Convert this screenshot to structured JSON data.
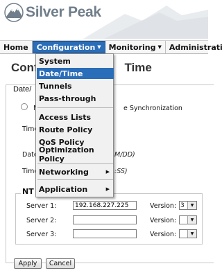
{
  "brand": {
    "name": "Silver Peak"
  },
  "nav": [
    {
      "label": "Home"
    },
    {
      "label": "Configuration",
      "caret": "▼"
    },
    {
      "label": "Monitoring",
      "caret": "▼"
    },
    {
      "label": "Administrati"
    }
  ],
  "page": {
    "title_left": "Confi",
    "title_right": "Time",
    "fieldset_legend": "Date/",
    "radio_left": "M",
    "radio_right": "e Synchronization",
    "time_label": "Time",
    "date_label": "Date",
    "date_format": "M/DD)",
    "time2_label": "Time",
    "time_format": ":SS)"
  },
  "ntp": {
    "legend": "NT",
    "servers": [
      {
        "label": "Server 1:",
        "value": "192.168.227.225",
        "version_label": "Version:",
        "version": "3"
      },
      {
        "label": "Server 2:",
        "value": "",
        "version_label": "Version:",
        "version": ""
      },
      {
        "label": "Server 3:",
        "value": "",
        "version_label": "Version:",
        "version": ""
      }
    ]
  },
  "buttons": {
    "apply": "Apply",
    "cancel": "Cancel"
  },
  "dropdown": {
    "items": [
      {
        "label": "System"
      },
      {
        "label": "Date/Time",
        "selected": true
      },
      {
        "label": "Tunnels"
      },
      {
        "label": "Pass-through"
      },
      {
        "label": "Access Lists"
      },
      {
        "label": "Route Policy"
      },
      {
        "label": "QoS Policy"
      },
      {
        "label": "Optimization Policy"
      },
      {
        "label": "Networking",
        "submenu": true
      },
      {
        "label": "Application",
        "submenu": true
      }
    ],
    "submenu_arrow": "▶"
  },
  "colors": {
    "accent": "#2a6db8",
    "logo_gray": "#6f7e8a"
  }
}
